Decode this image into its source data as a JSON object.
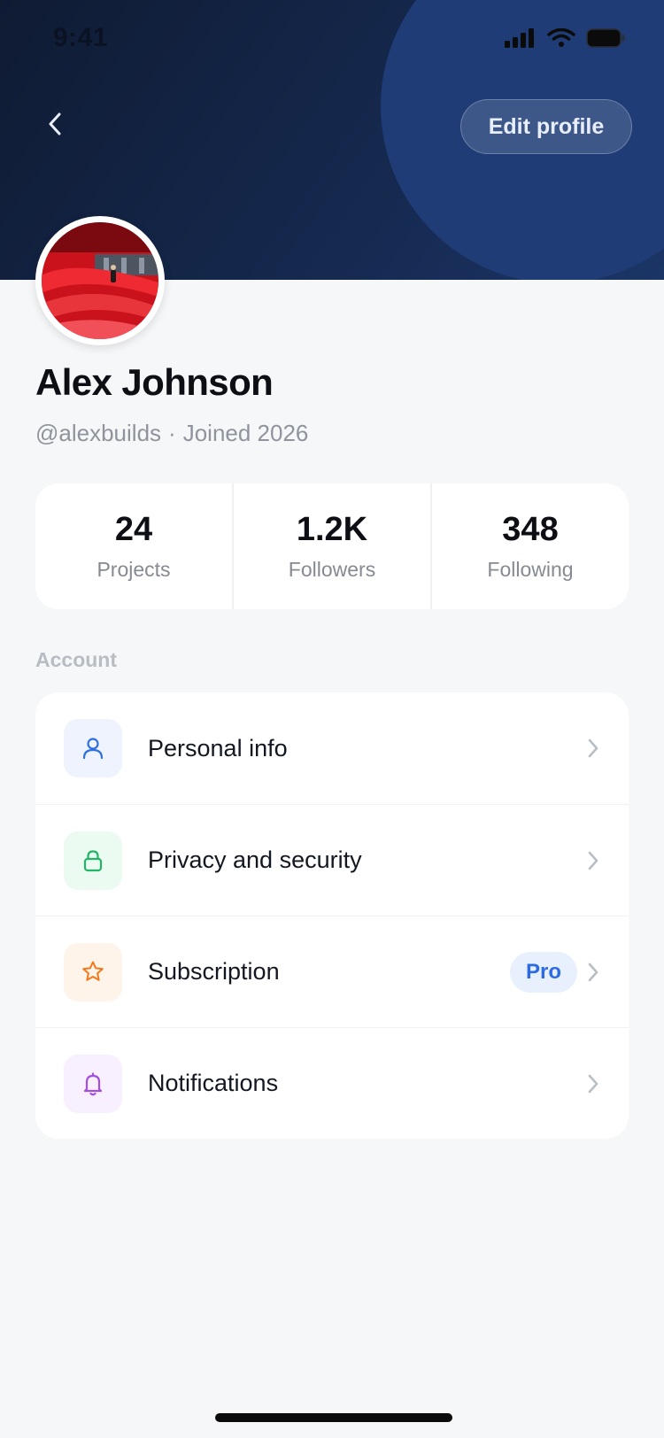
{
  "status_bar": {
    "time": "9:41"
  },
  "header": {
    "back_icon": "chevron-left-icon",
    "edit_button": "Edit profile",
    "colors": {
      "start": "#0f1b33",
      "end": "#1b3566",
      "circle": "#1f3c76"
    }
  },
  "profile": {
    "name": "Alex Johnson",
    "handle": "@alexbuilds",
    "separator": "·",
    "joined": "Joined 2026"
  },
  "stats": [
    {
      "value": "24",
      "label": "Projects"
    },
    {
      "value": "1.2K",
      "label": "Followers"
    },
    {
      "value": "348",
      "label": "Following"
    }
  ],
  "account": {
    "title": "Account",
    "items": [
      {
        "label": "Personal info",
        "icon": "person-icon",
        "color": "#2f6fe0",
        "tile": "#eef3fd"
      },
      {
        "label": "Privacy and security",
        "icon": "lock-icon",
        "color": "#22b567",
        "tile": "#ebfbf1"
      },
      {
        "label": "Subscription",
        "icon": "star-icon",
        "color": "#f07a1b",
        "tile": "#fff4e9",
        "badge": "Pro"
      },
      {
        "label": "Notifications",
        "icon": "bell-icon",
        "color": "#a24ee0",
        "tile": "#f8efff"
      }
    ]
  }
}
